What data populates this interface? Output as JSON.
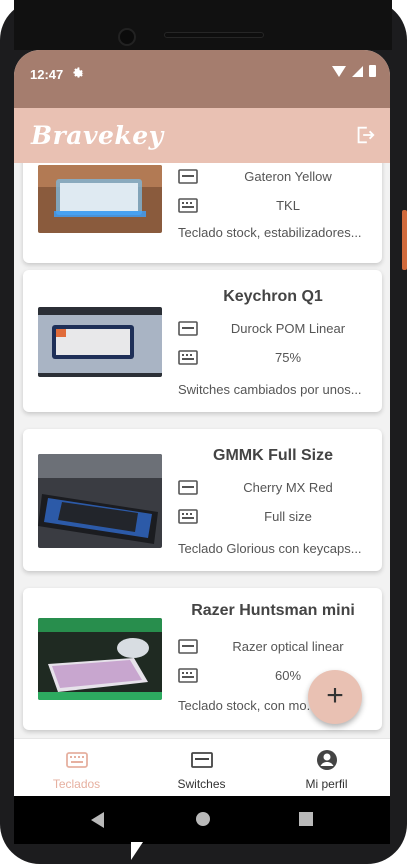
{
  "status_bar": {
    "time": "12:47",
    "settings_icon": "gear-icon"
  },
  "app_bar": {
    "title": "Bravekey",
    "logout_icon": "logout-icon"
  },
  "keyboards": [
    {
      "name": "",
      "switch": "Gateron Yellow",
      "size": "TKL",
      "description": "Teclado stock, estabilizadores..."
    },
    {
      "name": "Keychron Q1",
      "switch": "Durock POM Linear",
      "size": "75%",
      "description": "Switches cambiados por unos..."
    },
    {
      "name": "GMMK Full Size",
      "switch": "Cherry MX Red",
      "size": "Full size",
      "description": "Teclado Glorious con keycaps..."
    },
    {
      "name": "Razer Huntsman mini",
      "switch": "Razer optical linear",
      "size": "60%",
      "description": "Teclado stock, con mo..."
    }
  ],
  "fab": {
    "label": "+"
  },
  "bottom_nav": [
    {
      "label": "Teclados",
      "icon": "keyboard-icon",
      "active": true
    },
    {
      "label": "Switches",
      "icon": "switch-card-icon",
      "active": false
    },
    {
      "label": "Mi perfil",
      "icon": "account-icon",
      "active": false
    }
  ],
  "colors": {
    "status_bar": "#a57d6e",
    "app_bar": "#e9c1b3",
    "accent": "#e9c1b3",
    "active_nav": "#e6b0a0"
  }
}
